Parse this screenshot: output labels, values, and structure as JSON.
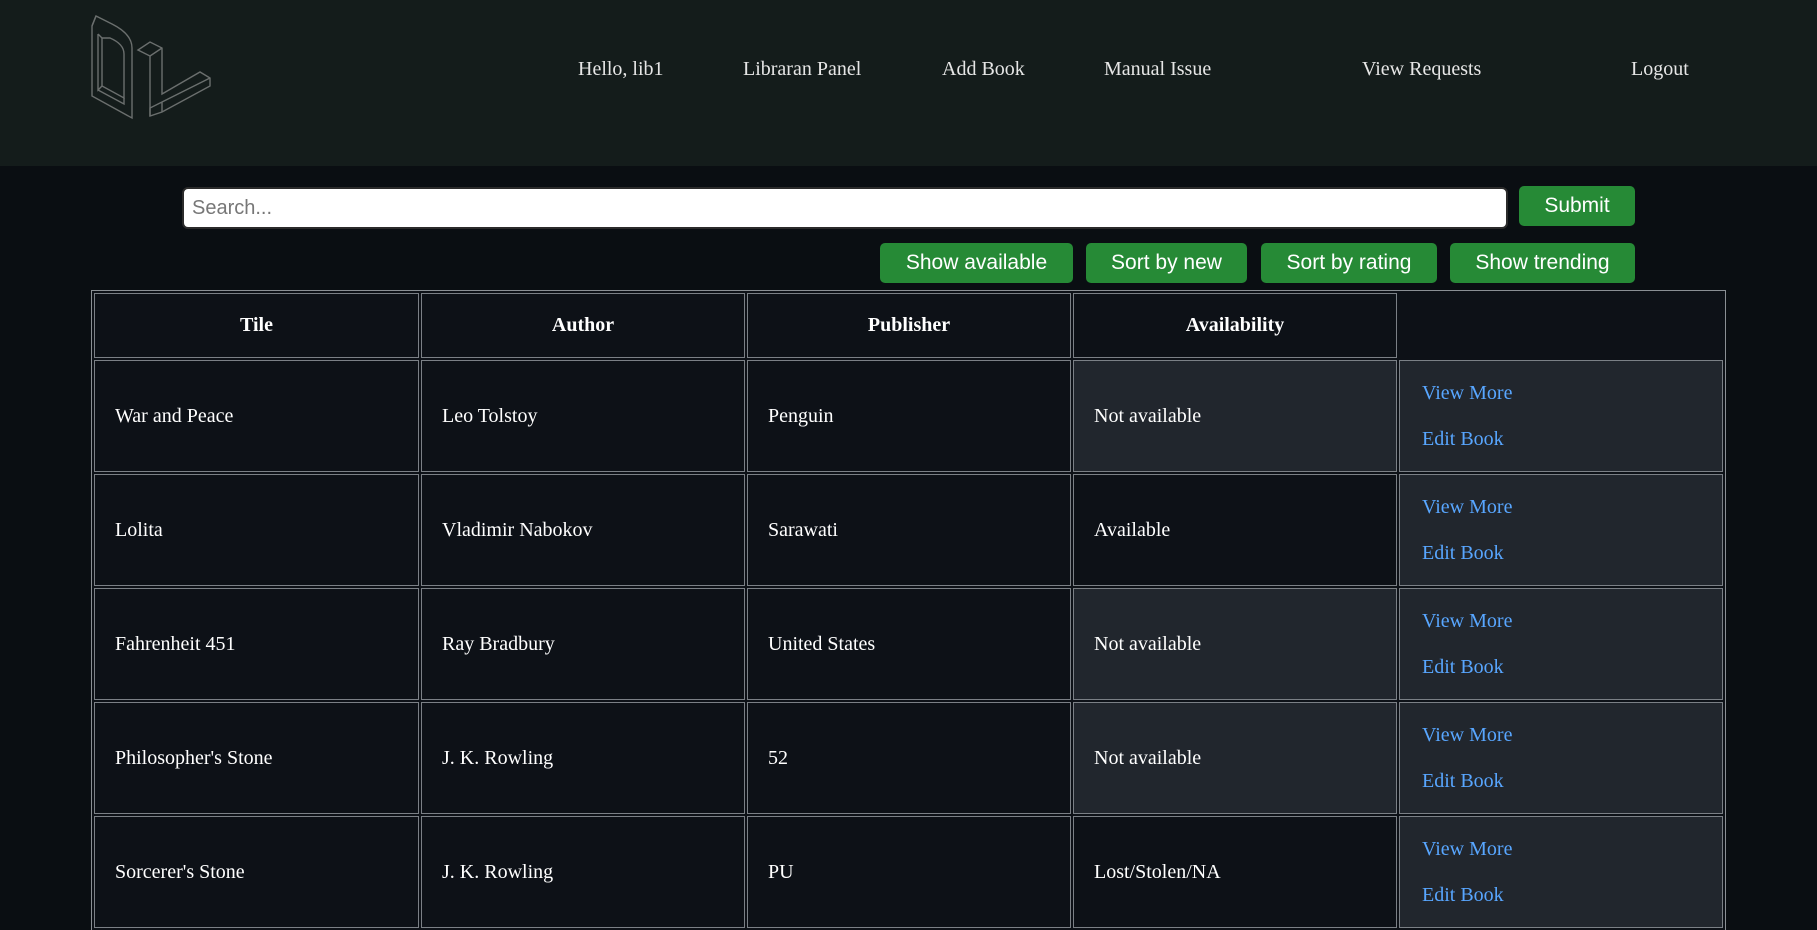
{
  "nav": {
    "greeting": "Hello, lib1",
    "librarian_panel": "Libraran Panel",
    "add_book": "Add Book",
    "manual_issue": "Manual Issue",
    "view_requests": "View Requests",
    "logout": "Logout"
  },
  "search": {
    "placeholder": "Search...",
    "submit_label": "Submit"
  },
  "filters": {
    "show_available": "Show available",
    "sort_new": "Sort by new",
    "sort_rating": "Sort by rating",
    "show_trending": "Show trending"
  },
  "table": {
    "headers": [
      "Tile",
      "Author",
      "Publisher",
      "Availability",
      ""
    ],
    "rows": [
      {
        "title": "War and Peace",
        "author": "Leo Tolstoy",
        "publisher": "Penguin",
        "availability": "Not available"
      },
      {
        "title": "Lolita",
        "author": "Vladimir Nabokov",
        "publisher": "Sarawati",
        "availability": "Available"
      },
      {
        "title": "Fahrenheit 451",
        "author": "Ray Bradbury",
        "publisher": "United States",
        "availability": "Not available"
      },
      {
        "title": "Philosopher's Stone",
        "author": "J. K. Rowling",
        "publisher": "52",
        "availability": "Not available"
      },
      {
        "title": "Sorcerer's Stone",
        "author": "J. K. Rowling",
        "publisher": "PU",
        "availability": "Lost/Stolen/NA"
      }
    ],
    "view_more_label": "View More",
    "edit_book_label": "Edit Book"
  },
  "colors": {
    "header_bg": "#141c1b",
    "page_bg": "#0a0e12",
    "button_green": "#268a36",
    "link_blue": "#58a6ff",
    "cell_gray": "#21262d"
  },
  "icons": {
    "logo": "dl-logo-outline"
  }
}
